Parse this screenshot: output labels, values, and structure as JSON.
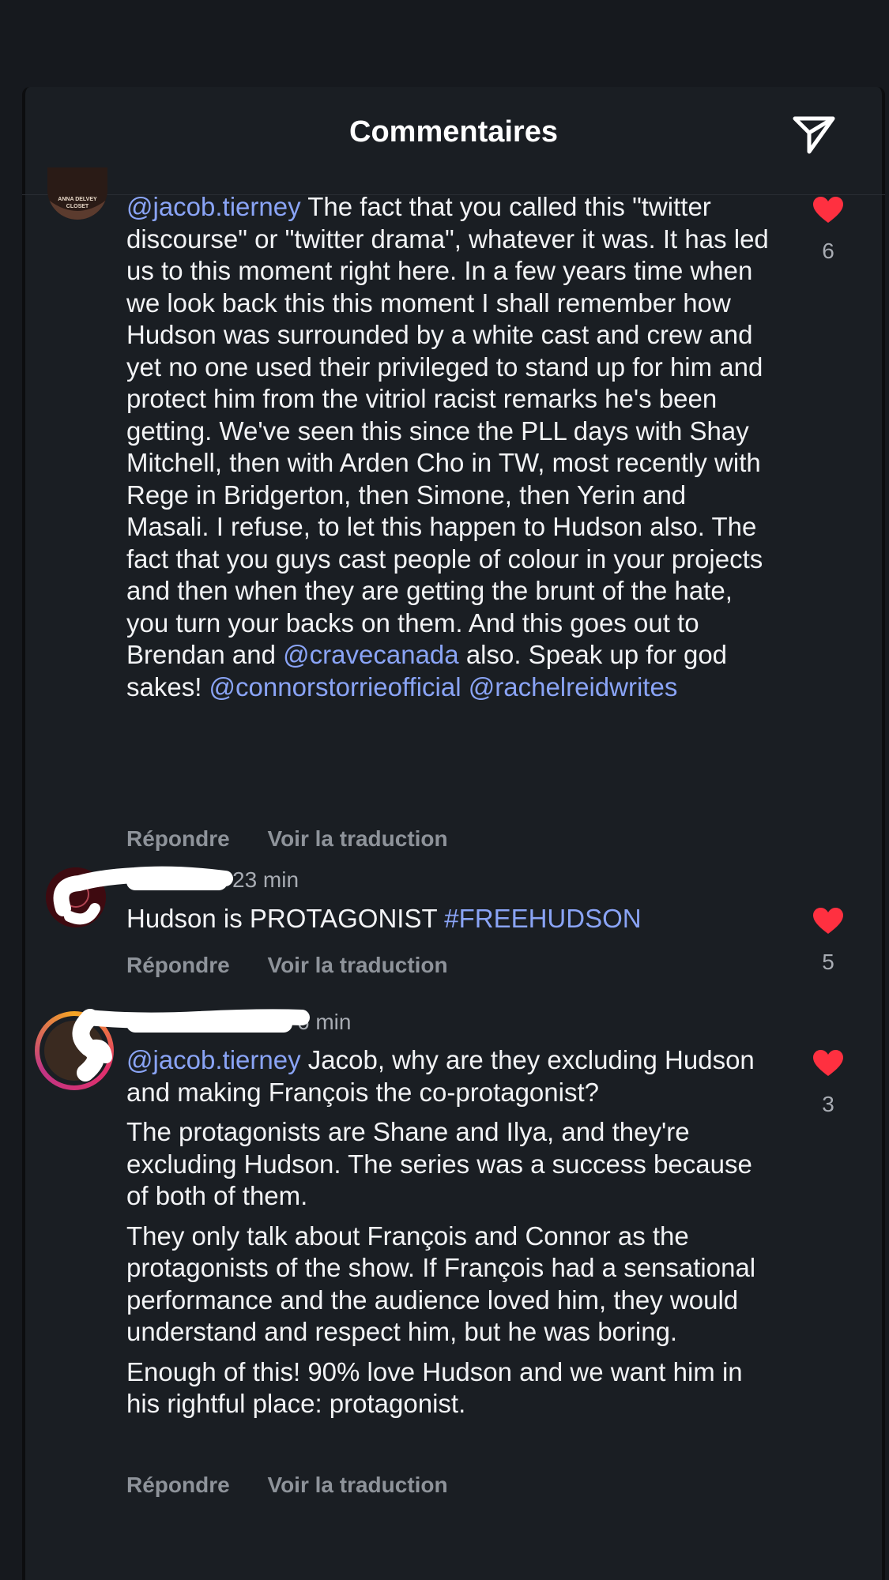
{
  "header": {
    "title": "Commentaires",
    "share_icon": "send-icon"
  },
  "comments": [
    {
      "avatar_text": "ANNA DELVEY CLOSET",
      "mention": "@jacob.tierney",
      "text_part1": "The fact that you called this \"twitter discourse\" or \"twitter drama\", whatever it was. It has led us to this moment right here. In a few years time when we look back this this moment I shall remember how Hudson was surrounded by a white cast and crew and yet no one used their privileged to stand up for him and protect him from the vitriol racist remarks he's been getting. We've seen this since the PLL days with Shay Mitchell, then with Arden Cho in TW, most recently with Rege in Bridgerton, then Simone, then Yerin and Masali. I refuse, to let this happen to Hudson also. The fact that you guys cast people of colour in your projects and then when they are getting the brunt of the hate, you turn your backs on them. And this goes out to Brendan and",
      "mention2": "@cravecanada",
      "text_part2": "also. Speak up for god sakes!",
      "mention3": "@connorstorrieofficial",
      "mention4": "@rachelreidwrites",
      "likes": "6",
      "reply": "Répondre",
      "translate": "Voir la traduction"
    },
    {
      "time": "23 min",
      "text": "Hudson is PROTAGONIST",
      "hashtag": "#FREEHUDSON",
      "likes": "5",
      "reply": "Répondre",
      "translate": "Voir la traduction"
    },
    {
      "time": "6 min",
      "mention": "@jacob.tierney",
      "p1": "Jacob, why are they excluding Hudson and making François the co-protagonist?",
      "p2": "The protagonists are Shane and Ilya, and they're excluding Hudson. The series was a success because of both of them.",
      "p3": "They only talk about François and Connor as the protagonists of the show. If François had a sensational performance and the audience loved him, they would understand and respect him, but he was boring.",
      "p4": "Enough of this! 90% love Hudson and we want him in his rightful place: protagonist.",
      "likes": "3",
      "reply": "Répondre",
      "translate": "Voir la traduction"
    }
  ],
  "colors": {
    "background": "#1a1e23",
    "mention": "#8aa4f6",
    "like": "#ff3040",
    "muted": "#8e939a"
  }
}
